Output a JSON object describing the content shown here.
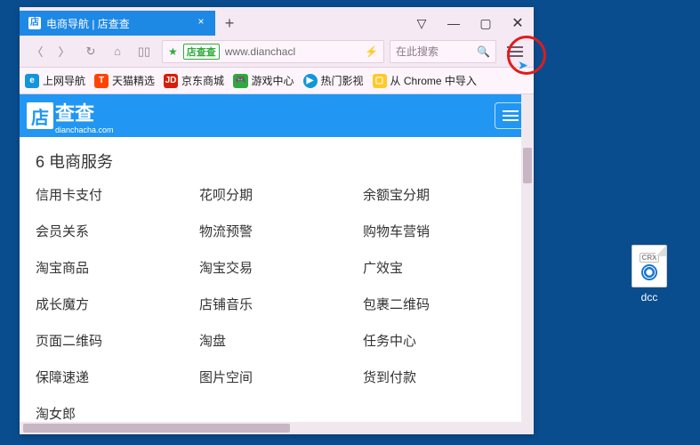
{
  "tab": {
    "title": "电商导航 | 店查查"
  },
  "addressbar": {
    "site_badge": "店查查",
    "url": "www.dianchacl"
  },
  "searchbox": {
    "placeholder": "在此搜索"
  },
  "bookmarks": [
    {
      "icon": "e",
      "label": "上网导航"
    },
    {
      "icon": "T",
      "label": "天猫精选"
    },
    {
      "icon": "JD",
      "label": "京东商城"
    },
    {
      "icon": "🎮",
      "label": "游戏中心"
    },
    {
      "icon": "▶",
      "label": "热门影视"
    },
    {
      "icon": "📁",
      "label": "从 Chrome 中导入"
    }
  ],
  "page": {
    "logo_char": "店",
    "logo_text": "查查",
    "logo_sub": "dianchacha.com",
    "section_number": "6",
    "section_title": "电商服务",
    "links": [
      "信用卡支付",
      "花呗分期",
      "余额宝分期",
      "会员关系",
      "物流预警",
      "购物车营销",
      "淘宝商品",
      "淘宝交易",
      "广效宝",
      "成长魔方",
      "店铺音乐",
      "包裹二维码",
      "页面二维码",
      "淘盘",
      "任务中心",
      "保障速递",
      "图片空间",
      "货到付款",
      "淘女郎"
    ]
  },
  "desktop": {
    "badge": "CRX",
    "filename": "dcc"
  }
}
